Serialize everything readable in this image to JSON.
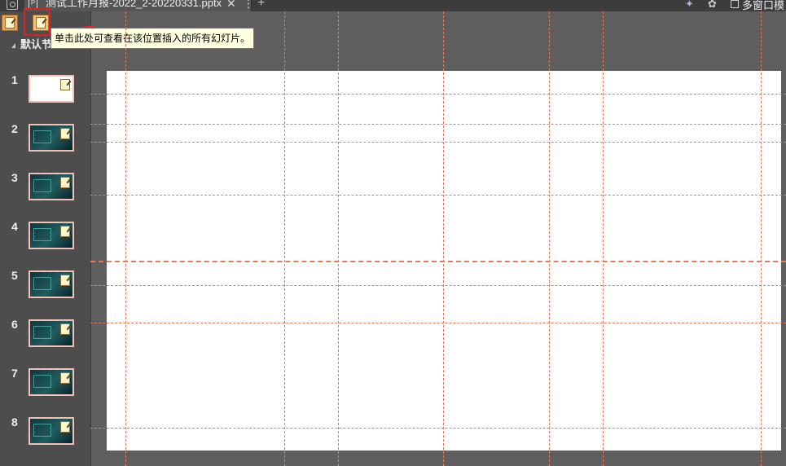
{
  "tab": {
    "title": "测试工作月报-2022_2-20220331.pptx",
    "close_glyph": "✕",
    "more_glyph": "⋮",
    "file_glyph": "P"
  },
  "tabbar": {
    "new_tab_glyph": "+",
    "multi_window_label": "多窗口模"
  },
  "panel": {
    "section_label": "默认节",
    "slides": [
      {
        "number": "1",
        "style": "white"
      },
      {
        "number": "2",
        "style": "dark"
      },
      {
        "number": "3",
        "style": "dark"
      },
      {
        "number": "4",
        "style": "dark"
      },
      {
        "number": "5",
        "style": "dark"
      },
      {
        "number": "6",
        "style": "dark"
      },
      {
        "number": "7",
        "style": "dark"
      },
      {
        "number": "8",
        "style": "dark"
      }
    ]
  },
  "tooltip": {
    "text": "单击此处可查看在该位置插入的所有幻灯片。"
  },
  "icons": {
    "app": "app-icon",
    "file": "pptx-file-icon",
    "insert_slide": "insert-slide-icon",
    "wand": "magic-wand-icon",
    "settings": "gear-icon"
  },
  "colors": {
    "guide": "#e8785a",
    "highlight": "#e02020",
    "tooltip_bg": "#ffffe1",
    "thumb_border": "#f3c2b6",
    "dark_slide": "#10343c"
  }
}
